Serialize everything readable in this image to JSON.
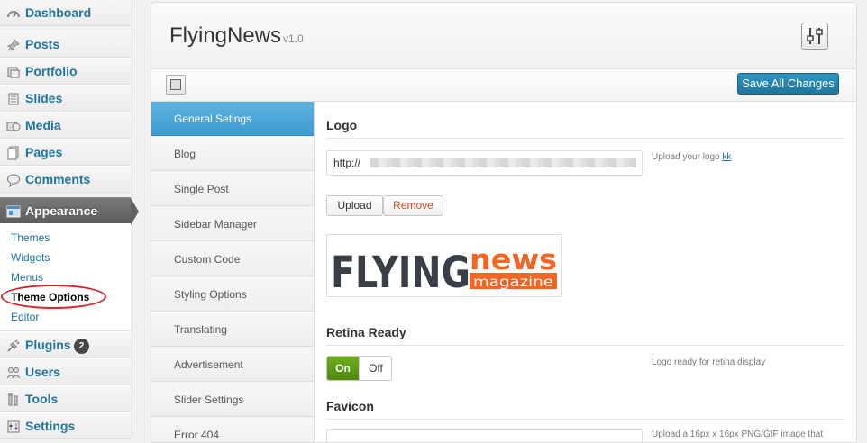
{
  "admin_menu": {
    "items": [
      {
        "label": "Dashboard",
        "icon": "dashboard-icon"
      },
      {
        "label": "Posts",
        "icon": "pushpin-icon"
      },
      {
        "label": "Portfolio",
        "icon": "portfolio-icon"
      },
      {
        "label": "Slides",
        "icon": "slides-icon"
      },
      {
        "label": "Media",
        "icon": "media-icon"
      },
      {
        "label": "Pages",
        "icon": "pages-icon"
      },
      {
        "label": "Comments",
        "icon": "comments-icon"
      },
      {
        "label": "Appearance",
        "icon": "appearance-icon"
      },
      {
        "label": "Plugins",
        "icon": "plugins-icon",
        "badge": "2"
      },
      {
        "label": "Users",
        "icon": "users-icon"
      },
      {
        "label": "Tools",
        "icon": "tools-icon"
      },
      {
        "label": "Settings",
        "icon": "settings-icon"
      }
    ],
    "appearance_submenu": [
      "Themes",
      "Widgets",
      "Menus",
      "Theme Options",
      "Editor"
    ]
  },
  "panel": {
    "title": "FlyingNews",
    "version": "v1.0",
    "save_label": "Save All Changes"
  },
  "options_nav": [
    "General Setings",
    "Blog",
    "Single Post",
    "Sidebar Manager",
    "Custom Code",
    "Styling Options",
    "Translating",
    "Advertisement",
    "Slider Settings",
    "Error 404"
  ],
  "content": {
    "logo": {
      "title": "Logo",
      "value": "http://",
      "help_text": "Upload your logo",
      "help_link": "kk",
      "upload_label": "Upload",
      "remove_label": "Remove",
      "preview_text_main": "FLYING",
      "preview_text_news": "news",
      "preview_text_sub": "magazine"
    },
    "retina": {
      "title": "Retina Ready",
      "on_label": "On",
      "off_label": "Off",
      "help_text": "Logo ready for retina display"
    },
    "favicon": {
      "title": "Favicon",
      "help_text": "Upload a 16px x 16px PNG/GIF image that"
    }
  },
  "colors": {
    "accent": "#3c9bd0",
    "link": "#21759b",
    "toggle_on": "#5a9a17",
    "remove": "#d54e21",
    "logo_orange": "#f26522",
    "logo_dark": "#3a3f47"
  }
}
